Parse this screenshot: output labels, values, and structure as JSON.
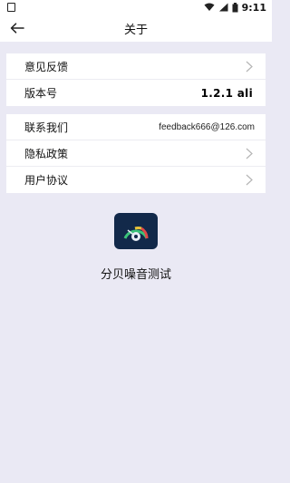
{
  "status_bar": {
    "time": "9:11",
    "icons": [
      "notification-icon",
      "wifi-icon",
      "signal-icon",
      "battery-icon"
    ]
  },
  "app_bar": {
    "title": "关于",
    "back_icon": "arrow-left-icon"
  },
  "group1": {
    "feedback_label": "意见反馈",
    "version_label": "版本号",
    "version_value": "1.2.1 ali"
  },
  "group2": {
    "contact_label": "联系我们",
    "contact_email": "feedback666@126.com",
    "privacy_label": "隐私政策",
    "agreement_label": "用户协议"
  },
  "app": {
    "name": "分贝噪音测试",
    "logo_icon": "decibel-meter-icon"
  },
  "colors": {
    "background": "#eae9f4",
    "surface": "#ffffff",
    "logo_bg": "#12294a",
    "chevron": "#b5b5b5"
  }
}
